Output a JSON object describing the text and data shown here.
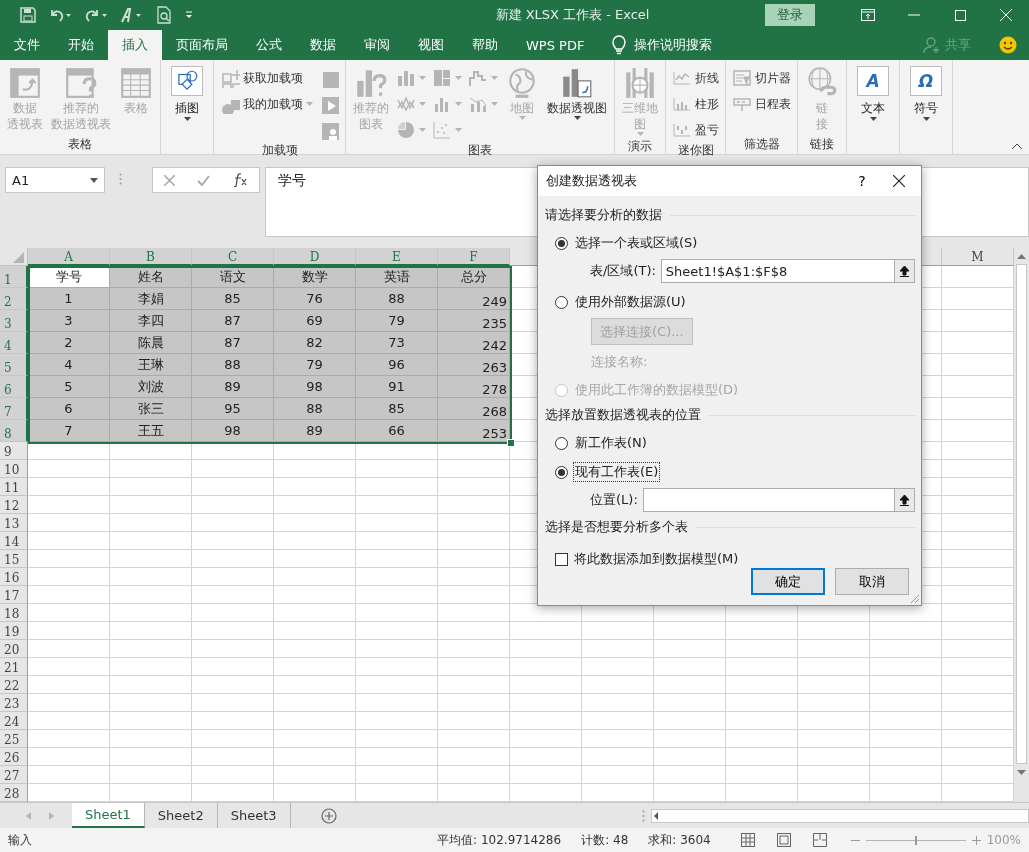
{
  "window": {
    "title": "新建 XLSX 工作表  -  Excel",
    "sign_in": "登录"
  },
  "menu_tabs": [
    {
      "label": "文件",
      "selected": false
    },
    {
      "label": "开始",
      "selected": false
    },
    {
      "label": "插入",
      "selected": true
    },
    {
      "label": "页面布局",
      "selected": false
    },
    {
      "label": "公式",
      "selected": false
    },
    {
      "label": "数据",
      "selected": false
    },
    {
      "label": "审阅",
      "selected": false
    },
    {
      "label": "视图",
      "selected": false
    },
    {
      "label": "帮助",
      "selected": false
    },
    {
      "label": "WPS PDF",
      "selected": false
    }
  ],
  "tell_me": "操作说明搜索",
  "share": "共享",
  "ribbon": {
    "groups": [
      {
        "label": "表格",
        "items": [
          {
            "kind": "large",
            "lines": [
              "数据",
              "透视表"
            ],
            "disabled": true,
            "caret": false
          },
          {
            "kind": "large",
            "lines": [
              "推荐的",
              "数据透视表"
            ],
            "disabled": true,
            "caret": false
          },
          {
            "kind": "large",
            "lines": [
              "表格"
            ],
            "disabled": true,
            "caret": false
          }
        ]
      },
      {
        "items": [
          {
            "kind": "boxed",
            "label": "插图",
            "disabled": false,
            "caret": true
          }
        ]
      },
      {
        "label": "加载项",
        "items": [
          {
            "kind": "stack",
            "items": [
              {
                "kind": "small",
                "label": "获取加载项",
                "disabled": true,
                "caret": false
              },
              {
                "kind": "small",
                "label": "我的加载项",
                "disabled": true,
                "caret": true
              }
            ]
          },
          {
            "kind": "stack",
            "items": [
              {
                "kind": "icon",
                "disabled": true,
                "caret": false
              },
              {
                "kind": "icon",
                "disabled": true,
                "caret": false
              },
              {
                "kind": "icon",
                "disabled": true,
                "caret": false
              }
            ]
          }
        ]
      },
      {
        "label": "图表",
        "items": [
          {
            "kind": "large",
            "lines": [
              "推荐的",
              "图表"
            ],
            "disabled": true,
            "caret": false
          },
          {
            "kind": "stack",
            "items": [
              {
                "kind": "icon",
                "disabled": true,
                "caret": true
              },
              {
                "kind": "icon",
                "disabled": true,
                "caret": true
              },
              {
                "kind": "icon",
                "disabled": true,
                "caret": true
              }
            ]
          },
          {
            "kind": "stack",
            "items": [
              {
                "kind": "icon",
                "disabled": true,
                "caret": true
              },
              {
                "kind": "icon",
                "disabled": true,
                "caret": true
              },
              {
                "kind": "icon",
                "disabled": true,
                "caret": true
              }
            ]
          },
          {
            "kind": "stack",
            "items": [
              {
                "kind": "icon",
                "disabled": true,
                "caret": true
              },
              {
                "kind": "icon",
                "disabled": true,
                "caret": true
              }
            ]
          },
          {
            "kind": "large",
            "lines": [
              "地图"
            ],
            "disabled": true,
            "caret": true
          },
          {
            "kind": "large",
            "lines": [
              "数据透视图"
            ],
            "disabled": false,
            "caret": true
          }
        ]
      },
      {
        "label": "演示",
        "items": [
          {
            "kind": "large",
            "lines": [
              "三维地",
              "图"
            ],
            "disabled": true,
            "caret": true
          }
        ]
      },
      {
        "label": "迷你图",
        "items": [
          {
            "kind": "stack",
            "items": [
              {
                "kind": "small",
                "label": "折线",
                "disabled": true,
                "caret": false
              },
              {
                "kind": "small",
                "label": "柱形",
                "disabled": true,
                "caret": false
              },
              {
                "kind": "small",
                "label": "盈亏",
                "disabled": true,
                "caret": false
              }
            ]
          }
        ]
      },
      {
        "label": "筛选器",
        "items": [
          {
            "kind": "stack",
            "items": [
              {
                "kind": "small",
                "label": "切片器",
                "disabled": true,
                "caret": false
              },
              {
                "kind": "small",
                "label": "日程表",
                "disabled": true,
                "caret": false
              }
            ]
          }
        ]
      },
      {
        "label": "链接",
        "items": [
          {
            "kind": "large",
            "lines": [
              "链",
              "接"
            ],
            "disabled": true,
            "caret": false
          }
        ]
      },
      {
        "items": [
          {
            "kind": "boxed",
            "glyph": "A",
            "label": "文本",
            "disabled": false,
            "caret": true
          }
        ]
      },
      {
        "items": [
          {
            "kind": "boxed",
            "glyph": "Ω",
            "label": "符号",
            "disabled": false,
            "caret": true
          }
        ]
      }
    ]
  },
  "formula_bar": {
    "name_box": "A1",
    "content": "学号"
  },
  "sheet": {
    "columns_left": [
      {
        "label": "A",
        "selected": true
      },
      {
        "label": "B",
        "selected": true
      },
      {
        "label": "C",
        "selected": true
      },
      {
        "label": "D",
        "selected": true
      },
      {
        "label": "E",
        "selected": true
      },
      {
        "label": "F",
        "selected": true
      }
    ],
    "columns_right": [
      {
        "label": "M",
        "selected": false
      }
    ],
    "rows": [
      {
        "number": "1",
        "selected": true,
        "cells": [
          {
            "text": "学号",
            "active": true
          },
          {
            "text": "姓名",
            "active": false
          },
          {
            "text": "语文",
            "active": false
          },
          {
            "text": "数学",
            "active": false
          },
          {
            "text": "英语",
            "active": false
          },
          {
            "text": "总分",
            "active": false
          }
        ]
      },
      {
        "number": "2",
        "selected": true,
        "cells": [
          {
            "text": "1",
            "active": false
          },
          {
            "text": "李娟",
            "active": false
          },
          {
            "text": "85",
            "active": false
          },
          {
            "text": "76",
            "active": false
          },
          {
            "text": "88",
            "active": false
          },
          {
            "text": "249",
            "active": false,
            "right_aligned": true
          }
        ]
      },
      {
        "number": "3",
        "selected": true,
        "cells": [
          {
            "text": "3",
            "active": false
          },
          {
            "text": "李四",
            "active": false
          },
          {
            "text": "87",
            "active": false
          },
          {
            "text": "69",
            "active": false
          },
          {
            "text": "79",
            "active": false
          },
          {
            "text": "235",
            "active": false,
            "right_aligned": true
          }
        ]
      },
      {
        "number": "4",
        "selected": true,
        "cells": [
          {
            "text": "2",
            "active": false
          },
          {
            "text": "陈晨",
            "active": false
          },
          {
            "text": "87",
            "active": false
          },
          {
            "text": "82",
            "active": false
          },
          {
            "text": "73",
            "active": false
          },
          {
            "text": "242",
            "active": false,
            "right_aligned": true
          }
        ]
      },
      {
        "number": "5",
        "selected": true,
        "cells": [
          {
            "text": "4",
            "active": false
          },
          {
            "text": "王琳",
            "active": false
          },
          {
            "text": "88",
            "active": false
          },
          {
            "text": "79",
            "active": false
          },
          {
            "text": "96",
            "active": false
          },
          {
            "text": "263",
            "active": false,
            "right_aligned": true
          }
        ]
      },
      {
        "number": "6",
        "selected": true,
        "cells": [
          {
            "text": "5",
            "active": false
          },
          {
            "text": "刘波",
            "active": false
          },
          {
            "text": "89",
            "active": false
          },
          {
            "text": "98",
            "active": false
          },
          {
            "text": "91",
            "active": false
          },
          {
            "text": "278",
            "active": false,
            "right_aligned": true
          }
        ]
      },
      {
        "number": "7",
        "selected": true,
        "cells": [
          {
            "text": "6",
            "active": false
          },
          {
            "text": "张三",
            "active": false
          },
          {
            "text": "95",
            "active": false
          },
          {
            "text": "88",
            "active": false
          },
          {
            "text": "85",
            "active": false
          },
          {
            "text": "268",
            "active": false,
            "right_aligned": true
          }
        ]
      },
      {
        "number": "8",
        "selected": true,
        "cells": [
          {
            "text": "7",
            "active": false
          },
          {
            "text": "王五",
            "active": false
          },
          {
            "text": "98",
            "active": false
          },
          {
            "text": "89",
            "active": false
          },
          {
            "text": "66",
            "active": false
          },
          {
            "text": "253",
            "active": false,
            "right_aligned": true
          }
        ]
      },
      {
        "number": "9",
        "selected": false
      },
      {
        "number": "10",
        "selected": false
      },
      {
        "number": "11",
        "selected": false
      },
      {
        "number": "12",
        "selected": false
      },
      {
        "number": "13",
        "selected": false
      },
      {
        "number": "14",
        "selected": false
      },
      {
        "number": "15",
        "selected": false
      },
      {
        "number": "16",
        "selected": false
      },
      {
        "number": "17",
        "selected": false
      },
      {
        "number": "18",
        "selected": false
      },
      {
        "number": "19",
        "selected": false
      },
      {
        "number": "20",
        "selected": false
      },
      {
        "number": "21",
        "selected": false
      },
      {
        "number": "22",
        "selected": false
      },
      {
        "number": "23",
        "selected": false
      },
      {
        "number": "24",
        "selected": false
      },
      {
        "number": "25",
        "selected": false
      },
      {
        "number": "26",
        "selected": false
      },
      {
        "number": "27",
        "selected": false
      },
      {
        "number": "28",
        "selected": false
      }
    ]
  },
  "sheet_tabs": [
    {
      "label": "Sheet1",
      "selected": true
    },
    {
      "label": "Sheet2",
      "selected": false
    },
    {
      "label": "Sheet3",
      "selected": false
    }
  ],
  "status_bar": {
    "mode": "输入",
    "stats": [
      "平均值: 102.9714286",
      "计数: 48",
      "求和: 3604"
    ],
    "zoom": "100%",
    "zoom_slider": {
      "level": 0.5
    }
  },
  "dialog": {
    "title": "创建数据透视表",
    "help": "?",
    "sections": [
      {
        "heading": "请选择要分析的数据",
        "items": [
          {
            "kind": "radio",
            "label": "选择一个表或区域(S)",
            "selected": true,
            "disabled": false,
            "focused": false
          },
          {
            "kind": "field",
            "label": "表/区域(T):",
            "value": "Sheet1!$A$1:$F$8"
          },
          {
            "kind": "radio",
            "label": "使用外部数据源(U)",
            "selected": false,
            "disabled": false,
            "focused": false
          },
          {
            "kind": "button",
            "label": "选择连接(C)...",
            "disabled": true
          },
          {
            "kind": "note",
            "label": "连接名称:",
            "disabled": true
          },
          {
            "kind": "radio",
            "label": "使用此工作簿的数据模型(D)",
            "selected": false,
            "disabled": true,
            "focused": false
          }
        ]
      },
      {
        "heading": "选择放置数据透视表的位置",
        "items": [
          {
            "kind": "radio",
            "label": "新工作表(N)",
            "selected": false,
            "disabled": false,
            "focused": false
          },
          {
            "kind": "radio",
            "label": "现有工作表(E)",
            "selected": true,
            "disabled": false,
            "focused": true
          },
          {
            "kind": "field",
            "label": "位置(L):"
          }
        ]
      },
      {
        "heading": "选择是否想要分析多个表",
        "items": [
          {
            "kind": "checkbox",
            "label": "将此数据添加到数据模型(M)",
            "checked": false
          }
        ]
      }
    ],
    "buttons": [
      {
        "label": "确定",
        "default": true
      },
      {
        "label": "取消",
        "default": false
      }
    ]
  }
}
